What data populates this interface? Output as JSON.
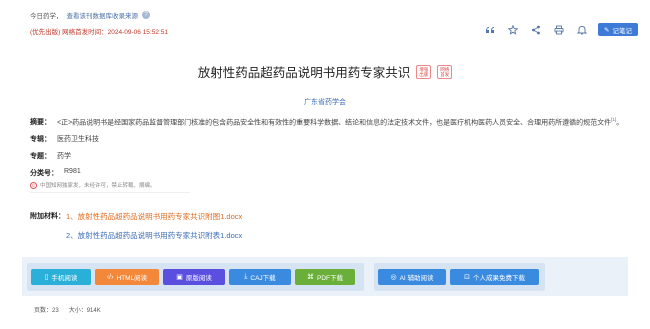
{
  "header": {
    "today_label": "今日药学，",
    "db_link": "查看该刊数据库收录来源",
    "help_glyph": "?",
    "publish_info": "(优先出版) 网络首发时间：2024-09-06 15:52:51"
  },
  "toolbar": {
    "icons": [
      "quote-icon",
      "star-icon",
      "share-icon",
      "print-icon",
      "bell-icon"
    ],
    "note_label": "记笔记"
  },
  "article": {
    "title": "放射性药品超药品说明书用药专家共识",
    "badges": [
      "增强出版",
      "网络首发"
    ],
    "author": "广东省药学会",
    "abstract_label": "摘要：",
    "abstract": "<正>药品说明书是经国家药品监督管理部门核准的包含药品安全性和有效性的重要科学数据、结论和信息的法定技术文件，也是医疗机构医药人员安全、合理用药所遵循的规范文件",
    "abstract_ref": "[1]",
    "abstract_end": "。",
    "series_label": "专辑：",
    "series": "医药卫生科技",
    "topic_label": "专题：",
    "topic": "药学",
    "class_label": "分类号：",
    "class_no": "R981",
    "copyright": "中国知网独家发，未经许可，禁止转载、摘编。"
  },
  "attachments": {
    "label": "附加材料：",
    "items": [
      "1、放射性药品超药品说明书用药专家共识附图1.docx",
      "2、放射性药品超药品说明书用药专家共识附表1.docx"
    ]
  },
  "downloads": {
    "mobile": "手机阅读",
    "html": "HTML阅读",
    "original": "原版阅读",
    "caj": "CAJ下载",
    "pdf": "PDF下载",
    "ai": "AI 辅助阅读",
    "personal": "个人成果免费下载"
  },
  "file_info": {
    "pages": "页数：23",
    "size": "大小：914K"
  }
}
